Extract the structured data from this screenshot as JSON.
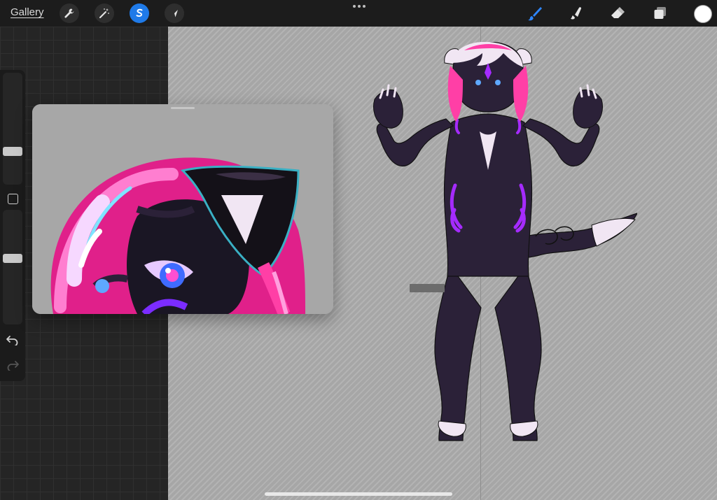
{
  "toolbar": {
    "gallery_label": "Gallery",
    "left_tools": [
      {
        "name": "actions",
        "icon": "wrench-icon"
      },
      {
        "name": "adjustments",
        "icon": "magic-wand-icon"
      },
      {
        "name": "selection",
        "icon": "selection-s-icon",
        "active": true
      },
      {
        "name": "transform",
        "icon": "arrow-cursor-icon"
      }
    ],
    "right_tools": [
      {
        "name": "brush",
        "icon": "brush-icon",
        "active": true
      },
      {
        "name": "smudge",
        "icon": "smudge-icon"
      },
      {
        "name": "eraser",
        "icon": "eraser-icon"
      },
      {
        "name": "layers",
        "icon": "layers-icon"
      }
    ],
    "current_color": "#ffffff",
    "accent_color": "#1f7ae8"
  },
  "sidebar": {
    "brush_size_level": 0.28,
    "opacity_level": 0.58,
    "icons": [
      "modify-square-icon",
      "undo-icon",
      "redo-icon"
    ]
  },
  "reference_window": {
    "visible": true
  },
  "canvas": {
    "background": "transparent-checker",
    "accent_colors": [
      "#ff3fa6",
      "#2b2138",
      "#a52bff",
      "#f3e8f3"
    ]
  }
}
